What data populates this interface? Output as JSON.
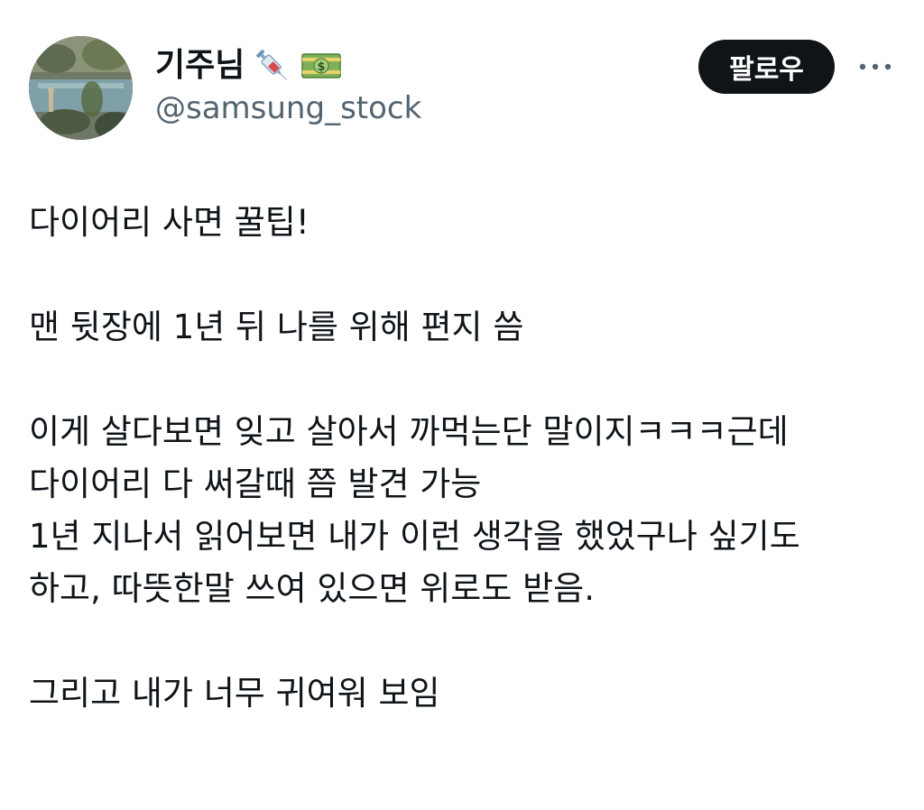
{
  "author": {
    "display_name": "기주님",
    "handle": "@samsung_stock",
    "name_icons": [
      "syringe-icon",
      "dollar-banknote-icon"
    ]
  },
  "follow_button": {
    "label": "팔로우"
  },
  "more_button": {
    "icon": "more-dots-icon"
  },
  "tweet": {
    "paragraphs": [
      [
        "다이어리 사면 꿀팁!"
      ],
      [
        "맨 뒷장에 1년 뒤 나를 위해 편지 씀"
      ],
      [
        "이게 살다보면 잊고 살아서 까먹는단 말이지ㅋㅋㅋ근데",
        "다이어리 다 써갈때 쯤 발견 가능",
        "1년 지나서 읽어보면 내가 이런 생각을 했었구나 싶기도",
        "하고, 따뜻한말 쓰여 있으면 위로도 받음."
      ],
      [
        "그리고 내가 너무 귀여워 보임"
      ]
    ]
  },
  "colors": {
    "text_primary": "#0f1419",
    "text_secondary": "#536471",
    "button_bg": "#0f1419",
    "button_text": "#ffffff"
  }
}
